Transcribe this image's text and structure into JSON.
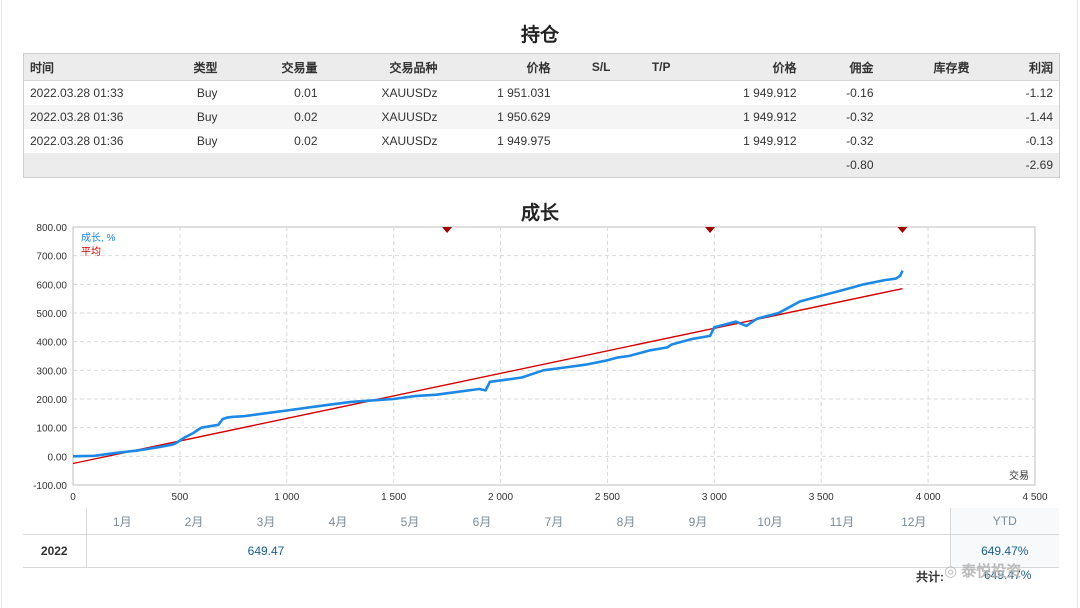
{
  "positions": {
    "title": "持仓",
    "headers": {
      "time": "时间",
      "type": "类型",
      "volume": "交易量",
      "symbol": "交易品种",
      "open_price": "价格",
      "sl": "S/L",
      "tp": "T/P",
      "current_price": "价格",
      "commission": "佣金",
      "swap": "库存费",
      "profit": "利润"
    },
    "rows": [
      {
        "time": "2022.03.28 01:33",
        "type": "Buy",
        "volume": "0.01",
        "symbol": "XAUUSDz",
        "open_price": "1 951.031",
        "current_price": "1 949.912",
        "commission": "-0.16",
        "profit": "-1.12"
      },
      {
        "time": "2022.03.28 01:36",
        "type": "Buy",
        "volume": "0.02",
        "symbol": "XAUUSDz",
        "open_price": "1 950.629",
        "current_price": "1 949.912",
        "commission": "-0.32",
        "profit": "-1.44"
      },
      {
        "time": "2022.03.28 01:36",
        "type": "Buy",
        "volume": "0.02",
        "symbol": "XAUUSDz",
        "open_price": "1 949.975",
        "current_price": "1 949.912",
        "commission": "-0.32",
        "profit": "-0.13"
      }
    ],
    "totals": {
      "commission": "-0.80",
      "profit": "-2.69"
    }
  },
  "growth": {
    "title": "成长",
    "xlabel": "交易",
    "colors": {
      "series": "#1e88e5",
      "average": "#d40000",
      "marker": "#a00000"
    }
  },
  "chart_data": {
    "type": "line",
    "xlim": [
      0,
      4500
    ],
    "ylim": [
      -100,
      800
    ],
    "xticks": [
      0,
      500,
      1000,
      1500,
      2000,
      2500,
      3000,
      3500,
      4000,
      4500
    ],
    "xtick_labels": [
      "0",
      "500",
      "1 000",
      "1 500",
      "2 000",
      "2 500",
      "3 000",
      "3 500",
      "4 000",
      "4 500"
    ],
    "yticks": [
      -100,
      0,
      100,
      200,
      300,
      400,
      500,
      600,
      700,
      800
    ],
    "ytick_labels": [
      "-100.00",
      "0.00",
      "100.00",
      "200.00",
      "300.00",
      "400.00",
      "500.00",
      "600.00",
      "700.00",
      "800.00"
    ],
    "grid": true,
    "legend": "top-left",
    "series": [
      {
        "name": "成长, %",
        "x": [
          0,
          100,
          200,
          300,
          400,
          460,
          480,
          500,
          520,
          560,
          580,
          600,
          680,
          700,
          720,
          750,
          800,
          900,
          1000,
          1100,
          1200,
          1300,
          1400,
          1500,
          1600,
          1700,
          1800,
          1900,
          1930,
          1950,
          2000,
          2100,
          2200,
          2300,
          2400,
          2500,
          2550,
          2600,
          2700,
          2780,
          2800,
          2900,
          2980,
          3000,
          3050,
          3100,
          3150,
          3180,
          3200,
          3300,
          3350,
          3400,
          3500,
          3600,
          3700,
          3800,
          3850,
          3870,
          3880
        ],
        "y": [
          0,
          2,
          12,
          20,
          32,
          40,
          45,
          55,
          65,
          80,
          90,
          100,
          110,
          130,
          135,
          138,
          140,
          150,
          160,
          170,
          180,
          190,
          195,
          200,
          210,
          215,
          225,
          235,
          230,
          260,
          265,
          275,
          300,
          310,
          320,
          335,
          345,
          350,
          370,
          380,
          390,
          410,
          420,
          450,
          460,
          470,
          455,
          470,
          480,
          500,
          520,
          540,
          560,
          580,
          600,
          615,
          620,
          630,
          648
        ]
      },
      {
        "name": "平均",
        "x": [
          0,
          3880
        ],
        "y": [
          -25,
          585
        ]
      }
    ],
    "markers_top": [
      1750,
      2980,
      3880
    ]
  },
  "monthly": {
    "months": [
      "1月",
      "2月",
      "3月",
      "4月",
      "5月",
      "6月",
      "7月",
      "8月",
      "9月",
      "10月",
      "11月",
      "12月"
    ],
    "ytd_header": "YTD",
    "year": "2022",
    "values": [
      "",
      "",
      "649.47",
      "",
      "",
      "",
      "",
      "",
      "",
      "",
      "",
      ""
    ],
    "ytd": "649.47%",
    "total_label": "共计:",
    "total": "649.47%"
  },
  "watermark": "泰悦投资"
}
